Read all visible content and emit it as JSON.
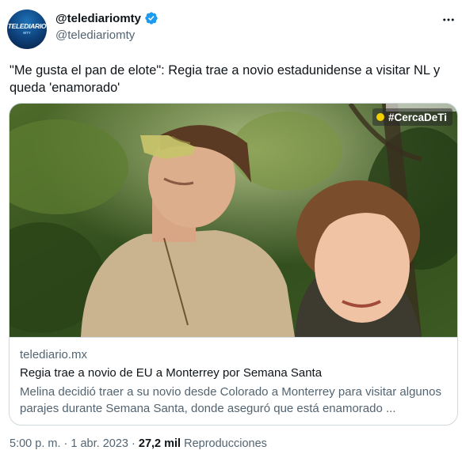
{
  "author": {
    "display_name": "@telediariomty",
    "handle": "@telediariomty",
    "avatar_text": "TELEDIARIO",
    "avatar_sub": "MTY",
    "verified": true
  },
  "tweet": {
    "text": "\"Me gusta el pan de elote\": Regia trae a novio estadunidense a visitar NL y queda 'enamorado'"
  },
  "card": {
    "hashtag": "#CercaDeTi",
    "domain": "telediario.mx",
    "title": "Regia trae a novio de EU a Monterrey por Semana Santa",
    "description": "Melina decidió traer a su novio desde Colorado a Monterrey para visitar algunos parajes durante Semana Santa, donde aseguró que está enamorado ..."
  },
  "meta": {
    "time": "5:00 p. m.",
    "separator": "·",
    "date": "1 abr. 2023",
    "views_count": "27,2 mil",
    "views_label": "Reproducciones"
  },
  "colors": {
    "verified_badge": "#1d9bf0",
    "secondary_text": "#536471",
    "primary_text": "#0f1419",
    "border": "#cfd9de"
  }
}
